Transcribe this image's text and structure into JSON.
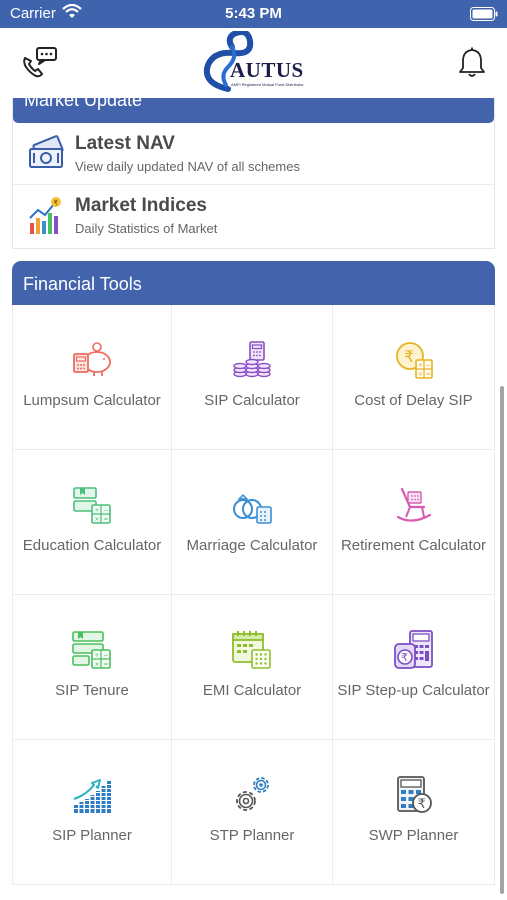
{
  "status_bar": {
    "carrier": "Carrier",
    "time": "5:43 PM"
  },
  "header": {
    "logo_text": "AUTUS",
    "logo_tagline": "AMFI Registered Mutual Fund Distributor",
    "left_icon": "phone-chat-icon",
    "right_icon": "bell-icon"
  },
  "market": {
    "title": "Market Update",
    "items": [
      {
        "title": "Latest NAV",
        "subtitle": "View daily updated NAV of all schemes",
        "icon": "money-icon"
      },
      {
        "title": "Market Indices",
        "subtitle": "Daily Statistics of Market",
        "icon": "bar-chart-icon"
      }
    ]
  },
  "tools": {
    "title": "Financial Tools",
    "items": [
      {
        "label": "Lumpsum Calculator",
        "icon": "piggy-bank-icon",
        "color": "#ef6b5e"
      },
      {
        "label": "SIP Calculator",
        "icon": "coins-icon",
        "color": "#8a4fc4"
      },
      {
        "label": "Cost of Delay SIP",
        "icon": "rupee-clock-icon",
        "color": "#e6b325"
      },
      {
        "label": "Education Calculator",
        "icon": "education-icon",
        "color": "#4bbf7b"
      },
      {
        "label": "Marriage Calculator",
        "icon": "rings-icon",
        "color": "#3a8fd4"
      },
      {
        "label": "Retirement Calculator",
        "icon": "rocking-chair-icon",
        "color": "#d75bb0"
      },
      {
        "label": "SIP Tenure",
        "icon": "tenure-icon",
        "color": "#4bbf5e"
      },
      {
        "label": "EMI Calculator",
        "icon": "calendar-calc-icon",
        "color": "#8fbf2f"
      },
      {
        "label": "SIP Step-up Calculator",
        "icon": "wallet-calc-icon",
        "color": "#7a4fc4"
      },
      {
        "label": "SIP Planner",
        "icon": "growth-chart-icon",
        "color": "#2f7ec4"
      },
      {
        "label": "STP Planner",
        "icon": "gears-icon",
        "color": "#555555"
      },
      {
        "label": "SWP Planner",
        "icon": "calc-rupee-icon",
        "color": "#555555"
      }
    ]
  },
  "colors": {
    "primary": "#4364ad",
    "status_bar": "#3f63ad"
  }
}
